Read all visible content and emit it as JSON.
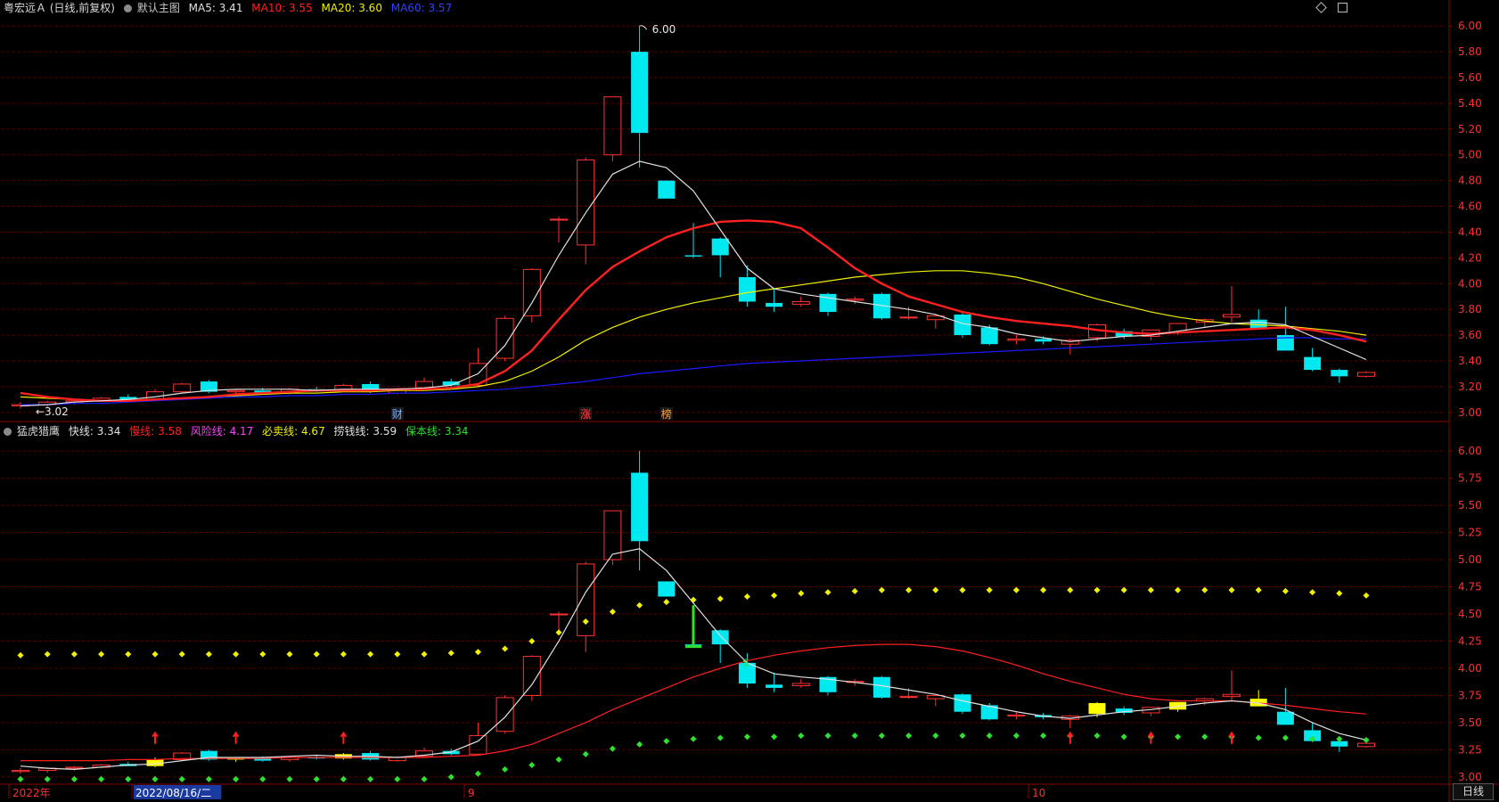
{
  "colors": {
    "background": "#000000",
    "up": "#ff3232",
    "down": "#00e8f0",
    "grid": "#5a0000",
    "axis": "#8a0000",
    "ma5": "#e0e0e0",
    "ma10": "#ff2020",
    "ma20": "#f0f000",
    "ma60": "#1a1aff",
    "risk": "#ff40ff",
    "safe": "#30e030"
  },
  "top_panel": {
    "title": "粤宏远Ａ (日线,前复权)",
    "main_label": "默认主图",
    "indicators": [
      {
        "name": "MA5",
        "value": "3.41",
        "color": "#e0e0e0"
      },
      {
        "name": "MA10",
        "value": "3.55",
        "color": "#ff2020"
      },
      {
        "name": "MA20",
        "value": "3.60",
        "color": "#f0f000"
      },
      {
        "name": "MA60",
        "value": "3.57",
        "color": "#3040ff"
      }
    ],
    "high_label": "6.00",
    "low_label": "3.02",
    "markers": [
      "财",
      "涨",
      "榜"
    ]
  },
  "bottom_panel": {
    "title": "猛虎猎鹰",
    "indicators": [
      {
        "name": "快线",
        "value": "3.34",
        "color": "#e0e0e0"
      },
      {
        "name": "慢线",
        "value": "3.58",
        "color": "#ff2020"
      },
      {
        "name": "风险线",
        "value": "4.17",
        "color": "#ff40ff"
      },
      {
        "name": "必卖线",
        "value": "4.67",
        "color": "#f0f000"
      },
      {
        "name": "捞钱线",
        "value": "3.59",
        "color": "#e0e0e0"
      },
      {
        "name": "保本线",
        "value": "3.34",
        "color": "#30e030"
      }
    ]
  },
  "x_axis": {
    "labels": [
      "2022年",
      "2022/08/16/二",
      "9",
      "10"
    ]
  },
  "period_tab": "日线",
  "chart_data": [
    {
      "type": "candlestick",
      "title": "粤宏远Ａ (日线,前复权)",
      "y_ticks": [
        "6.00",
        "5.80",
        "5.60",
        "5.40",
        "5.20",
        "5.00",
        "4.80",
        "4.60",
        "4.40",
        "4.20",
        "4.00",
        "3.80",
        "3.60",
        "3.40",
        "3.20",
        "3.00"
      ],
      "ylim": [
        2.95,
        6.05
      ],
      "candles": [
        [
          3.05,
          3.08,
          3.03,
          3.06
        ],
        [
          3.06,
          3.09,
          3.04,
          3.08
        ],
        [
          3.08,
          3.1,
          3.06,
          3.09
        ],
        [
          3.09,
          3.12,
          3.08,
          3.11
        ],
        [
          3.12,
          3.14,
          3.1,
          3.1
        ],
        [
          3.1,
          3.18,
          3.09,
          3.16
        ],
        [
          3.16,
          3.23,
          3.15,
          3.22
        ],
        [
          3.24,
          3.25,
          3.15,
          3.16
        ],
        [
          3.16,
          3.18,
          3.14,
          3.17
        ],
        [
          3.17,
          3.19,
          3.14,
          3.15
        ],
        [
          3.16,
          3.19,
          3.14,
          3.18
        ],
        [
          3.18,
          3.2,
          3.16,
          3.17
        ],
        [
          3.17,
          3.22,
          3.16,
          3.21
        ],
        [
          3.22,
          3.24,
          3.15,
          3.16
        ],
        [
          3.15,
          3.19,
          3.14,
          3.18
        ],
        [
          3.19,
          3.27,
          3.18,
          3.24
        ],
        [
          3.24,
          3.26,
          3.2,
          3.21
        ],
        [
          3.21,
          3.5,
          3.2,
          3.38
        ],
        [
          3.42,
          3.75,
          3.4,
          3.73
        ],
        [
          3.75,
          4.12,
          3.7,
          4.11
        ],
        [
          4.5,
          4.52,
          4.32,
          4.5
        ],
        [
          4.3,
          4.98,
          4.15,
          4.96
        ],
        [
          5.0,
          5.45,
          4.95,
          5.45
        ],
        [
          5.8,
          6.0,
          4.9,
          5.17
        ],
        [
          4.8,
          4.8,
          4.66,
          4.66
        ],
        [
          4.22,
          4.47,
          4.2,
          4.21
        ],
        [
          4.35,
          4.36,
          4.05,
          4.22
        ],
        [
          4.05,
          4.14,
          3.82,
          3.86
        ],
        [
          3.85,
          3.96,
          3.78,
          3.82
        ],
        [
          3.84,
          3.9,
          3.82,
          3.86
        ],
        [
          3.92,
          3.93,
          3.75,
          3.78
        ],
        [
          3.87,
          3.9,
          3.84,
          3.88
        ],
        [
          3.92,
          3.93,
          3.72,
          3.73
        ],
        [
          3.74,
          3.82,
          3.72,
          3.74
        ],
        [
          3.72,
          3.76,
          3.65,
          3.75
        ],
        [
          3.76,
          3.77,
          3.58,
          3.6
        ],
        [
          3.66,
          3.68,
          3.52,
          3.53
        ],
        [
          3.56,
          3.6,
          3.53,
          3.57
        ],
        [
          3.57,
          3.59,
          3.53,
          3.55
        ],
        [
          3.53,
          3.57,
          3.45,
          3.56
        ],
        [
          3.58,
          3.69,
          3.55,
          3.68
        ],
        [
          3.63,
          3.65,
          3.57,
          3.59
        ],
        [
          3.59,
          3.64,
          3.56,
          3.64
        ],
        [
          3.62,
          3.69,
          3.6,
          3.69
        ],
        [
          3.7,
          3.73,
          3.66,
          3.72
        ],
        [
          3.74,
          3.98,
          3.7,
          3.76
        ],
        [
          3.72,
          3.8,
          3.65,
          3.65
        ],
        [
          3.6,
          3.82,
          3.48,
          3.48
        ],
        [
          3.43,
          3.5,
          3.32,
          3.33
        ],
        [
          3.33,
          3.34,
          3.23,
          3.28
        ],
        [
          3.28,
          3.32,
          3.27,
          3.31
        ]
      ],
      "ma5": [
        3.05,
        3.06,
        3.08,
        3.09,
        3.1,
        3.12,
        3.15,
        3.17,
        3.18,
        3.18,
        3.18,
        3.17,
        3.18,
        3.18,
        3.18,
        3.19,
        3.21,
        3.3,
        3.52,
        3.85,
        4.22,
        4.55,
        4.85,
        4.95,
        4.9,
        4.72,
        4.42,
        4.12,
        3.96,
        3.92,
        3.89,
        3.86,
        3.83,
        3.8,
        3.76,
        3.69,
        3.66,
        3.61,
        3.58,
        3.55,
        3.57,
        3.59,
        3.6,
        3.63,
        3.66,
        3.69,
        3.7,
        3.68,
        3.59,
        3.5,
        3.41
      ],
      "ma10": [
        3.15,
        3.12,
        3.1,
        3.09,
        3.09,
        3.1,
        3.11,
        3.12,
        3.14,
        3.15,
        3.16,
        3.17,
        3.17,
        3.17,
        3.18,
        3.18,
        3.19,
        3.22,
        3.32,
        3.48,
        3.72,
        3.95,
        4.13,
        4.25,
        4.36,
        4.43,
        4.48,
        4.49,
        4.48,
        4.43,
        4.28,
        4.12,
        4.0,
        3.9,
        3.84,
        3.78,
        3.74,
        3.71,
        3.69,
        3.67,
        3.64,
        3.62,
        3.61,
        3.62,
        3.63,
        3.64,
        3.65,
        3.66,
        3.64,
        3.6,
        3.55
      ],
      "ma20": [
        3.12,
        3.11,
        3.1,
        3.09,
        3.09,
        3.1,
        3.11,
        3.12,
        3.13,
        3.14,
        3.15,
        3.15,
        3.16,
        3.16,
        3.17,
        3.17,
        3.18,
        3.2,
        3.24,
        3.32,
        3.43,
        3.56,
        3.66,
        3.74,
        3.8,
        3.85,
        3.89,
        3.93,
        3.96,
        3.99,
        4.02,
        4.05,
        4.07,
        4.09,
        4.1,
        4.1,
        4.08,
        4.05,
        4.0,
        3.94,
        3.88,
        3.83,
        3.78,
        3.74,
        3.71,
        3.69,
        3.68,
        3.67,
        3.65,
        3.63,
        3.6
      ],
      "ma60": [
        3.06,
        3.06,
        3.07,
        3.07,
        3.08,
        3.09,
        3.1,
        3.11,
        3.12,
        3.12,
        3.13,
        3.13,
        3.14,
        3.14,
        3.15,
        3.15,
        3.16,
        3.17,
        3.18,
        3.2,
        3.22,
        3.24,
        3.27,
        3.3,
        3.32,
        3.34,
        3.36,
        3.38,
        3.39,
        3.4,
        3.41,
        3.42,
        3.43,
        3.44,
        3.45,
        3.46,
        3.47,
        3.48,
        3.49,
        3.5,
        3.51,
        3.52,
        3.53,
        3.54,
        3.55,
        3.56,
        3.57,
        3.58,
        3.58,
        3.57,
        3.57
      ]
    },
    {
      "type": "candlestick",
      "title": "猛虎猎鹰",
      "y_ticks": [
        "6.00",
        "5.75",
        "5.50",
        "5.25",
        "5.00",
        "4.75",
        "4.50",
        "4.25",
        "4.00",
        "3.75",
        "3.50",
        "3.25",
        "3.00"
      ],
      "ylim": [
        2.95,
        6.05
      ],
      "candles_same_as_top": true,
      "yellow_candles": [
        5,
        8,
        12,
        40,
        43,
        46
      ],
      "fast_line": [
        3.1,
        3.08,
        3.07,
        3.09,
        3.11,
        3.12,
        3.15,
        3.18,
        3.18,
        3.18,
        3.19,
        3.2,
        3.19,
        3.19,
        3.18,
        3.2,
        3.23,
        3.33,
        3.55,
        3.85,
        4.25,
        4.7,
        5.05,
        5.1,
        4.9,
        4.6,
        4.3,
        4.05,
        3.95,
        3.92,
        3.9,
        3.87,
        3.84,
        3.8,
        3.76,
        3.7,
        3.65,
        3.6,
        3.56,
        3.54,
        3.57,
        3.6,
        3.62,
        3.65,
        3.68,
        3.7,
        3.68,
        3.62,
        3.5,
        3.4,
        3.34
      ],
      "slow_line": [
        3.15,
        3.15,
        3.15,
        3.15,
        3.16,
        3.16,
        3.17,
        3.17,
        3.17,
        3.17,
        3.18,
        3.18,
        3.18,
        3.18,
        3.18,
        3.18,
        3.19,
        3.2,
        3.24,
        3.3,
        3.4,
        3.5,
        3.62,
        3.72,
        3.82,
        3.92,
        4.0,
        4.07,
        4.12,
        4.16,
        4.19,
        4.21,
        4.22,
        4.22,
        4.2,
        4.16,
        4.1,
        4.03,
        3.95,
        3.88,
        3.82,
        3.76,
        3.72,
        3.7,
        3.7,
        3.7,
        3.68,
        3.66,
        3.63,
        3.6,
        3.58
      ],
      "sell_line": [
        4.12,
        4.13,
        4.13,
        4.13,
        4.13,
        4.13,
        4.13,
        4.13,
        4.13,
        4.13,
        4.13,
        4.13,
        4.13,
        4.13,
        4.13,
        4.13,
        4.14,
        4.15,
        4.18,
        4.25,
        4.33,
        4.43,
        4.52,
        4.58,
        4.61,
        4.63,
        4.64,
        4.66,
        4.67,
        4.69,
        4.7,
        4.71,
        4.72,
        4.72,
        4.72,
        4.72,
        4.72,
        4.72,
        4.72,
        4.72,
        4.72,
        4.72,
        4.72,
        4.72,
        4.72,
        4.72,
        4.72,
        4.71,
        4.7,
        4.69,
        4.67
      ],
      "safe_line": [
        2.98,
        2.98,
        2.98,
        2.98,
        2.98,
        2.98,
        2.98,
        2.98,
        2.98,
        2.98,
        2.98,
        2.98,
        2.98,
        2.98,
        2.98,
        2.98,
        3.0,
        3.03,
        3.07,
        3.11,
        3.16,
        3.21,
        3.26,
        3.3,
        3.33,
        3.35,
        3.36,
        3.37,
        3.37,
        3.38,
        3.38,
        3.38,
        3.38,
        3.38,
        3.38,
        3.38,
        3.38,
        3.38,
        3.38,
        3.38,
        3.38,
        3.37,
        3.37,
        3.37,
        3.37,
        3.37,
        3.36,
        3.36,
        3.35,
        3.35,
        3.34
      ],
      "up_arrows": [
        5,
        8,
        12,
        39,
        42,
        45
      ],
      "buy_signal_index": 25,
      "s_marker_index": 27
    }
  ]
}
